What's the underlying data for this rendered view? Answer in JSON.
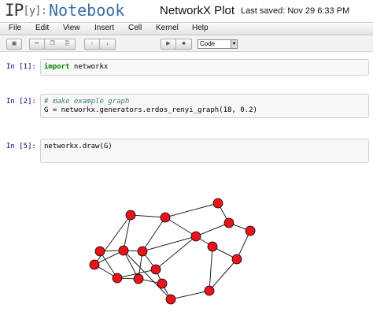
{
  "header": {
    "logo_text": "IP",
    "logo_bracket": "[y]:",
    "logo_notebook": "Notebook",
    "notebook_title": "NetworkX Plot",
    "save_status": "Last saved: Nov 29 6:33 PM"
  },
  "menu": [
    "File",
    "Edit",
    "View",
    "Insert",
    "Cell",
    "Kernel",
    "Help"
  ],
  "toolbar": {
    "buttons": [
      {
        "name": "save-icon",
        "glyph": "▣"
      },
      {
        "name": "cut-icon",
        "glyph": "✂"
      },
      {
        "name": "copy-icon",
        "glyph": "❐"
      },
      {
        "name": "paste-icon",
        "glyph": "⎘"
      },
      {
        "name": "move-up-icon",
        "glyph": "↑"
      },
      {
        "name": "move-down-icon",
        "glyph": "↓"
      },
      {
        "name": "run-icon",
        "glyph": "▶"
      },
      {
        "name": "run-all-icon",
        "glyph": "■"
      }
    ],
    "cell_type": "Code"
  },
  "cells": [
    {
      "prompt": "In [1]:",
      "keyword": "import",
      "code": " networkx"
    },
    {
      "prompt": "In [2]:",
      "comment": "# make example graph",
      "code": "G = networkx.generators.erdos_renyi_graph(18, 0.2)"
    },
    {
      "prompt": "In [5]:",
      "code": "networkx.draw(G)"
    }
  ],
  "graph": {
    "node_color": "#e8131b",
    "edge_color": "#222222",
    "node_count": 18
  }
}
